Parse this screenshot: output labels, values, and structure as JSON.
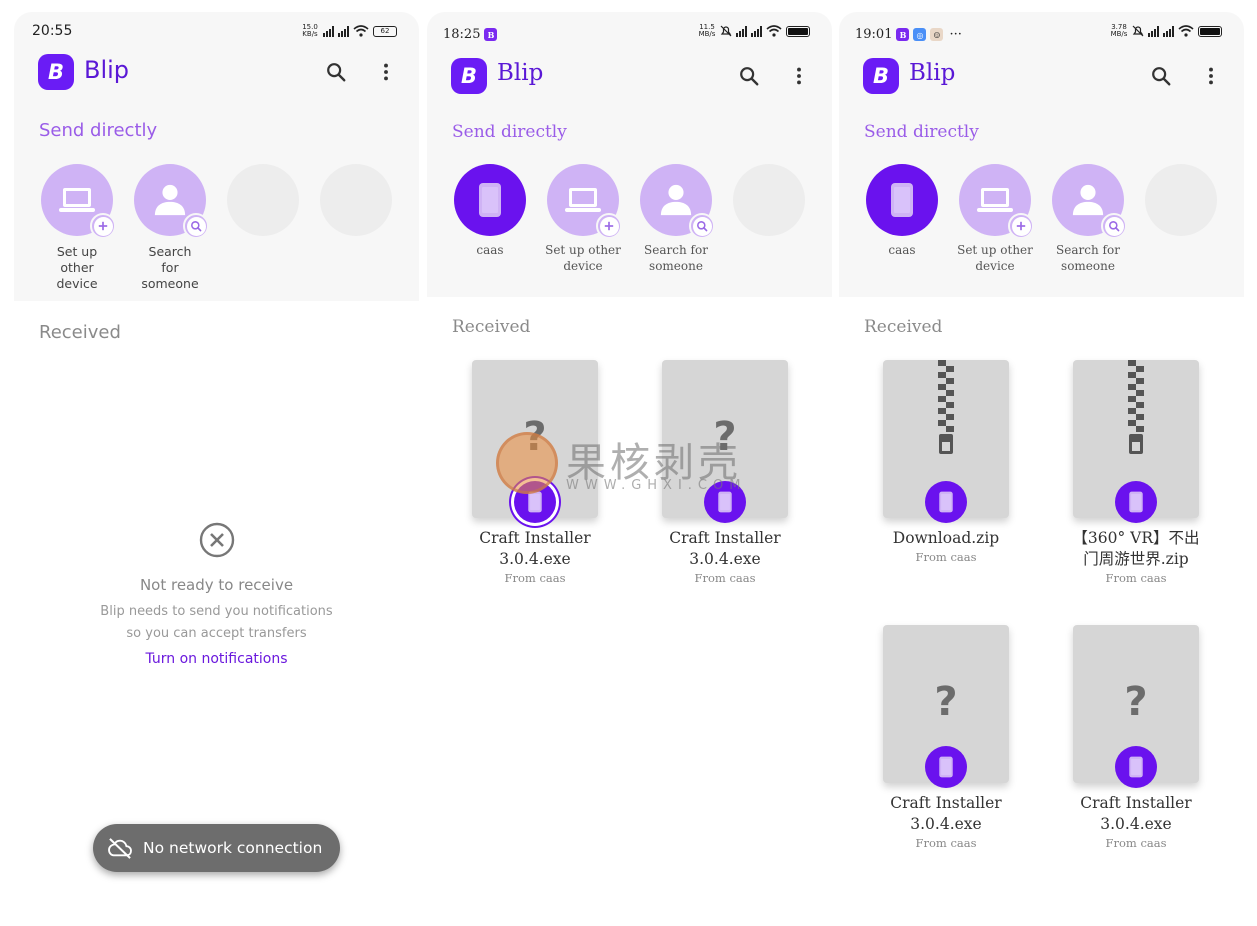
{
  "app": {
    "name": "Blip",
    "logo_letter": "B"
  },
  "colors": {
    "accent": "#6a12ee",
    "accent_light": "#cfb3f5",
    "section_title": "#9a5ce8",
    "link": "#6a18dd"
  },
  "screens": [
    {
      "status": {
        "time": "20:55",
        "speed": "15.0 KB/s",
        "battery": "62"
      },
      "send_title": "Send directly",
      "devices": [
        {
          "label": "Set up other device",
          "icon": "laptop-icon",
          "badge": "plus-icon"
        },
        {
          "label": "Search for someone",
          "icon": "person-icon",
          "badge": "search-icon"
        }
      ],
      "received_title": "Received",
      "empty": {
        "title": "Not ready to receive",
        "desc_line1": "Blip needs to send you notifications",
        "desc_line2": "so you can accept transfers",
        "link": "Turn on notifications"
      },
      "toast": "No network connection"
    },
    {
      "status": {
        "time": "18:25",
        "speed": "11.5 MB/s"
      },
      "send_title": "Send directly",
      "devices": [
        {
          "label": "caas",
          "icon": "phone-icon"
        },
        {
          "label": "Set up other device",
          "icon": "laptop-icon",
          "badge": "plus-icon"
        },
        {
          "label": "Search for someone",
          "icon": "person-icon",
          "badge": "search-icon"
        }
      ],
      "received_title": "Received",
      "files": [
        {
          "name_line1": "Craft Installer",
          "name_line2": "3.0.4.exe",
          "from": "From caas",
          "type": "unknown"
        },
        {
          "name_line1": "Craft Installer",
          "name_line2": "3.0.4.exe",
          "from": "From caas",
          "type": "unknown"
        }
      ]
    },
    {
      "status": {
        "time": "19:01",
        "speed": "3.78 MB/s"
      },
      "send_title": "Send directly",
      "devices": [
        {
          "label": "caas",
          "icon": "phone-icon"
        },
        {
          "label": "Set up other device",
          "icon": "laptop-icon",
          "badge": "plus-icon"
        },
        {
          "label": "Search for someone",
          "icon": "person-icon",
          "badge": "search-icon"
        }
      ],
      "received_title": "Received",
      "files": [
        {
          "name_line1": "Download.zip",
          "name_line2": "",
          "from": "From caas",
          "type": "zip"
        },
        {
          "name_line1": "【360° VR】不出",
          "name_line2": "门周游世界.zip",
          "from": "From caas",
          "type": "zip"
        },
        {
          "name_line1": "Craft Installer",
          "name_line2": "3.0.4.exe",
          "from": "From caas",
          "type": "unknown"
        },
        {
          "name_line1": "Craft Installer",
          "name_line2": "3.0.4.exe",
          "from": "From caas",
          "type": "unknown"
        }
      ]
    }
  ],
  "watermark": {
    "text": "果核剥壳",
    "url": "WWW.GHXI.COM"
  }
}
